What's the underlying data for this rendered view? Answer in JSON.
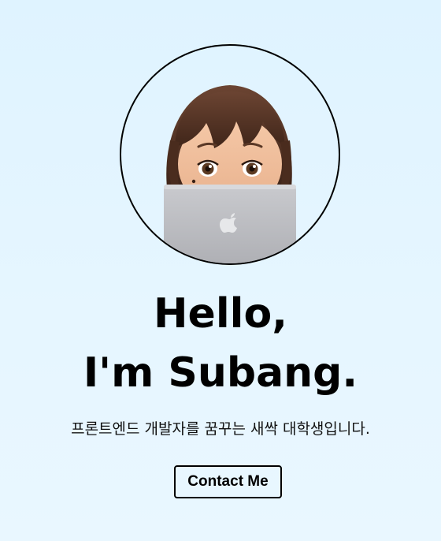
{
  "hero": {
    "avatar_description": "memoji-girl-behind-laptop",
    "headline_line1": "Hello,",
    "headline_line2": "I'm Subang.",
    "tagline": "프론트엔드 개발자를 꿈꾸는 새싹 대학생입니다.",
    "contact_label": "Contact Me"
  },
  "colors": {
    "background": "#e2f4ff",
    "text": "#000000",
    "button_border": "#000000"
  },
  "icons": {
    "laptop_logo": "apple-logo-icon"
  }
}
